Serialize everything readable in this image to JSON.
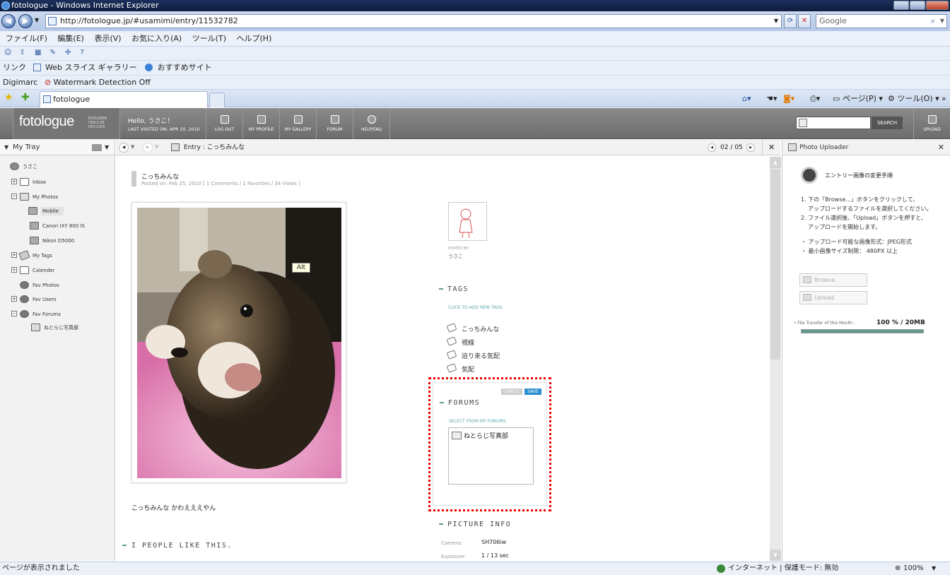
{
  "window": {
    "title": "fotologue - Windows Internet Explorer"
  },
  "address": {
    "url": "http://fotologue.jp/#usamimi/entry/11532782",
    "search_placeholder": "Google"
  },
  "menu": [
    "ファイル(F)",
    "編集(E)",
    "表示(V)",
    "お気に入り(A)",
    "ツール(T)",
    "ヘルプ(H)"
  ],
  "links": {
    "label": "リンク",
    "web_slice": "Web スライス ギャラリー",
    "recommended": "おすすめサイト"
  },
  "digimarc": {
    "label": "Digimarc",
    "watermark": "Watermark Detection Off"
  },
  "tab": {
    "title": "fotologue",
    "page_label": "ページ(P)",
    "tools_label": "ツール(O)"
  },
  "header": {
    "logo": "fotologue",
    "logo_sub": "EXPLORER VER.2.08 REV.2305",
    "hello": "Hello, うさこ！",
    "last_visited": "LAST VISITED ON: APR 10. 2010",
    "buttons": [
      "LOG OUT",
      "MY PROFILE",
      "MY GALLERY",
      "FORUM",
      "HELP/FAQ"
    ],
    "search_label": "SEARCH",
    "upload_label": "UPLOAD"
  },
  "tray": {
    "title": "My Tray",
    "user": "うさこ",
    "inbox": "Inbox",
    "my_photos": "My Photos",
    "folders": [
      "Mobile",
      "Canon IXY 800 IS",
      "Nikon D5000"
    ],
    "my_tags": "My Tags",
    "calendar": "Calender",
    "fav_photos": "Fav Photos",
    "fav_users": "Fav Users",
    "fav_forums": "Fav Forums",
    "forum_item": "ねとらじ写真部"
  },
  "entry": {
    "breadcrumb": "Entry : こっちみんな",
    "pager": "02 / 05",
    "title": "こっちみんな",
    "meta": "Posted on: Feb 25, 2010 [ 1 Comments / 1 Favorites / 34 Views ]",
    "caption": "こっちみんな かわえええやん",
    "tooltip": "Alt",
    "posted_by_label": "POSTED BY:",
    "posted_by": "うさこ",
    "people_like": "I PEOPLE LIKE THIS."
  },
  "tags": {
    "heading": "TAGS",
    "add_hint": "CLICK TO ADD NEW TAGS.",
    "items": [
      "こっちみんな",
      "視線",
      "迫り来る気配",
      "気配"
    ]
  },
  "forums": {
    "heading": "FORUMS",
    "hint": "SELECT FROM MY FORUMS.",
    "cancel": "CANCEL",
    "save": "SAVE",
    "item": "ねとらじ写真部"
  },
  "picture_info": {
    "heading": "PICTURE INFO",
    "rows": [
      {
        "label": "Camera:",
        "value": "SH706iw"
      },
      {
        "label": "Exposure:",
        "value": "1 / 13 sec"
      }
    ]
  },
  "uploader": {
    "title": "Photo Uploader",
    "heading": "エントリー画像の変更手順",
    "step1a": "1. 下の「Browse...」ボタンをクリックして、",
    "step1b": "アップロードするファイルを選択してください。",
    "step2a": "2. ファイル選択後、「Upload」ボタンを押すと、",
    "step2b": "アップロードを開始します。",
    "note1": "・ アップロード可能な画像形式：JPEG形式",
    "note2": "・ 最小画像サイズ制限： 480PX 以上",
    "browse": "Browse..",
    "upload": "Upload",
    "transfer_label": "File Transfer of this Month :",
    "transfer_value": "100 % / 20MB",
    "transfer_fraction": 1.0
  },
  "status": {
    "left": "ページが表示されました",
    "zone": "インターネット | 保護モード: 無効",
    "zoom": "100%"
  }
}
